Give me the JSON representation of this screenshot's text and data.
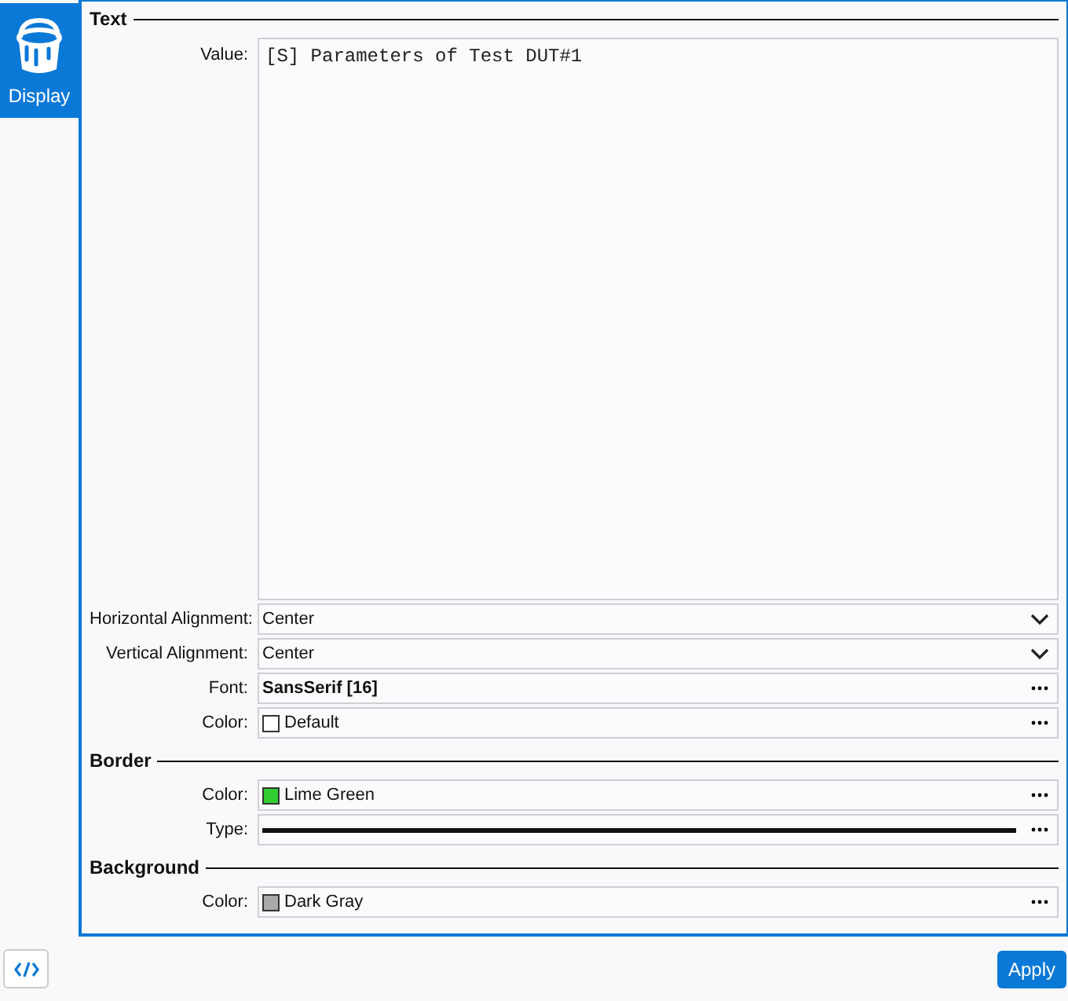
{
  "sidebar": {
    "items": [
      {
        "label": "Display",
        "selected": true
      }
    ]
  },
  "sections": [
    {
      "title": "Text",
      "fields": [
        {
          "kind": "textarea",
          "label": "Value:",
          "value": "[S] Parameters of Test DUT#1"
        },
        {
          "kind": "dropdown",
          "label": "Horizontal Alignment:",
          "value": "Center"
        },
        {
          "kind": "dropdown",
          "label": "Vertical Alignment:",
          "value": "Center"
        },
        {
          "kind": "font",
          "label": "Font:",
          "value": "SansSerif [16]"
        },
        {
          "kind": "color",
          "label": "Color:",
          "value": "Default",
          "color": "#ffffff"
        }
      ]
    },
    {
      "title": "Border",
      "fields": [
        {
          "kind": "color",
          "label": "Color:",
          "value": "Lime Green",
          "color": "#32cd32"
        },
        {
          "kind": "line",
          "label": "Type:"
        }
      ]
    },
    {
      "title": "Background",
      "fields": [
        {
          "kind": "color",
          "label": "Color:",
          "value": "Dark Gray",
          "color": "#a9a9a9"
        }
      ]
    }
  ],
  "footer": {
    "apply": "Apply"
  }
}
